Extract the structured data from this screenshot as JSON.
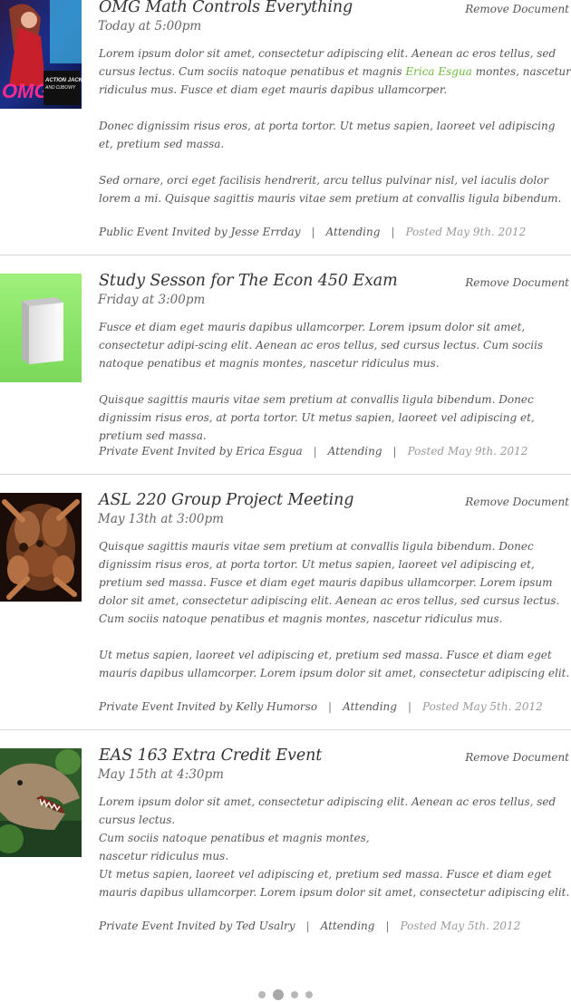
{
  "events": [
    {
      "title": "OMG Math Controls Everything",
      "when": "Today at 5:00pm",
      "remove_label": "Remove Document",
      "para1_a": "Lorem ipsum dolor sit amet, consectetur adipiscing elit. Aenean ac eros tellus, sed cursus lectus. Cum sociis natoque penatibus et magnis ",
      "para1_link": "Erica Esgua",
      "para1_b": " montes, nascetur ridiculus mus. Fusce et diam eget mauris dapibus ullamcorper.",
      "para2": "Donec dignissim risus eros, at porta tortor. Ut metus sapien, laoreet vel adipiscing et, pretium sed massa.",
      "para3": "Sed ornare, orci eget facilisis hendrerit, arcu tellus pulvinar nisl, vel iaculis dolor lorem a mi. Quisque sagittis mauris vitae sem pretium at convallis ligula bibendum.",
      "invited": "Public Event Invited by Jesse Errday",
      "status": "Attending",
      "posted": "Posted May 9th. 2012",
      "thumb": "concert-poster-image"
    },
    {
      "title": "Study Sesson for The Econ 450 Exam",
      "when": "Friday at 3:00pm",
      "remove_label": "Remove Document",
      "para1": "Fusce et diam eget mauris dapibus ullamcorper. Lorem ipsum dolor sit amet, consectetur adipi-scing elit. Aenean ac eros tellus, sed cursus lectus. Cum sociis natoque penatibus et magnis montes, nascetur ridiculus mus.",
      "para2": "Quisque sagittis mauris vitae sem pretium at convallis ligula bibendum. Donec dignissim risus eros, at porta tortor. Ut metus sapien, laoreet vel adipiscing et, pretium sed massa.",
      "invited": "Private Event Invited by Erica Esgua",
      "status": "Attending",
      "posted": "Posted May 9th. 2012",
      "thumb": "green-book-icon"
    },
    {
      "title": "ASL 220 Group Project Meeting",
      "when": "May 13th at 3:00pm",
      "remove_label": "Remove Document",
      "para1": "Quisque sagittis mauris vitae sem pretium at convallis ligula bibendum. Donec dignissim risus eros, at porta tortor. Ut metus sapien, laoreet vel adipiscing et, pretium sed massa. Fusce et diam eget mauris dapibus ullamcorper. Lorem ipsum dolor sit amet, consectetur adipiscing elit. Aenean ac eros tellus, sed cursus lectus. Cum sociis natoque penatibus et magnis montes, nascetur ridiculus mus.",
      "para2": "Ut metus sapien, laoreet vel adipiscing et, pretium sed massa. Fusce et diam eget mauris dapibus ullamcorper. Lorem ipsum dolor sit amet, consectetur adipiscing elit.",
      "invited": "Private Event Invited by Kelly Humorso",
      "status": "Attending",
      "posted": "Posted May 5th. 2012",
      "thumb": "hands-photo"
    },
    {
      "title": "EAS 163 Extra Credit Event",
      "when": "May 15th at 4:30pm",
      "remove_label": "Remove Document",
      "para1_l1": "Lorem ipsum dolor sit amet, consectetur adipiscing elit. Aenean ac eros tellus, sed cursus lectus.",
      "para1_l2": "Cum sociis natoque penatibus et magnis montes,",
      "para1_l3": "nascetur ridiculus mus.",
      "para2": "Ut metus sapien, laoreet vel adipiscing et, pretium sed massa. Fusce et diam eget mauris dapibus ullamcorper. Lorem ipsum dolor sit amet, consectetur adipiscing elit.",
      "invited": "Private Event Invited by Ted Usalry",
      "status": "Attending",
      "posted": "Posted May 5th. 2012",
      "thumb": "dinosaur-photo"
    }
  ],
  "pagination": {
    "pages": 4,
    "active": 2
  },
  "colors": {
    "link": "#6cbb3c",
    "divider": "#d8d8d8",
    "book_green": "#8ee36a"
  }
}
